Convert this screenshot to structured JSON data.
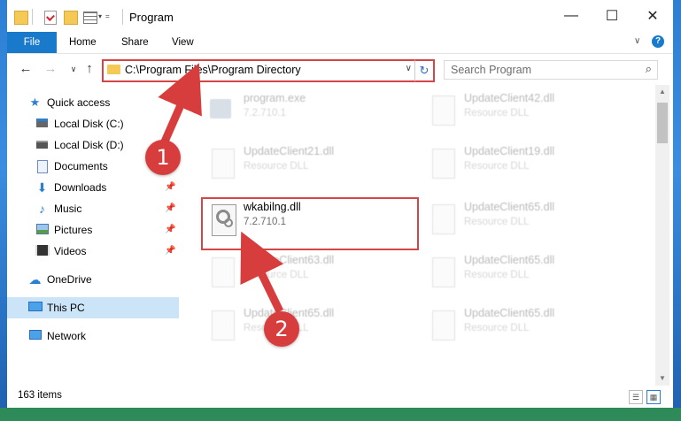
{
  "window": {
    "title": "Program"
  },
  "ribbon": {
    "tabs": [
      "File",
      "Home",
      "Share",
      "View"
    ]
  },
  "address": {
    "path": "C:\\Program Files\\Program Directory"
  },
  "search": {
    "placeholder": "Search Program"
  },
  "nav": {
    "items": [
      {
        "label": "Quick access",
        "icon": "star-icon"
      },
      {
        "label": "Local Disk (C:)",
        "icon": "drive-icon"
      },
      {
        "label": "Local Disk (D:)",
        "icon": "drive-icon"
      },
      {
        "label": "Documents",
        "icon": "documents-icon"
      },
      {
        "label": "Downloads",
        "icon": "download-icon"
      },
      {
        "label": "Music",
        "icon": "music-icon"
      },
      {
        "label": "Pictures",
        "icon": "pictures-icon"
      },
      {
        "label": "Videos",
        "icon": "videos-icon"
      },
      {
        "label": "OneDrive",
        "icon": "cloud-icon"
      },
      {
        "label": "This PC",
        "icon": "computer-icon"
      },
      {
        "label": "Network",
        "icon": "network-icon"
      }
    ]
  },
  "files": [
    {
      "name": "program.exe",
      "sub": "7.2.710.1"
    },
    {
      "name": "UpdateClient42.dll",
      "sub": "Resource DLL"
    },
    {
      "name": "UpdateClient21.dll",
      "sub": "Resource DLL"
    },
    {
      "name": "UpdateClient19.dll",
      "sub": "Resource DLL"
    },
    {
      "name": "wkabilng.dll",
      "sub": "7.2.710.1"
    },
    {
      "name": "UpdateClient65.dll",
      "sub": "Resource DLL"
    },
    {
      "name": "UpdateClient63.dll",
      "sub": "Resource DLL"
    },
    {
      "name": "UpdateClient65.dll",
      "sub": "Resource DLL"
    },
    {
      "name": "UpdateClient65.dll",
      "sub": "Resource DLL"
    },
    {
      "name": "UpdateClient65.dll",
      "sub": "Resource DLL"
    }
  ],
  "status": {
    "count": "163 items"
  },
  "annotations": {
    "step1": "1",
    "step2": "2"
  },
  "colors": {
    "accent": "#1979ca",
    "highlight": "#d64545",
    "badge": "#d83d3d",
    "selected": "#cce4f7"
  }
}
